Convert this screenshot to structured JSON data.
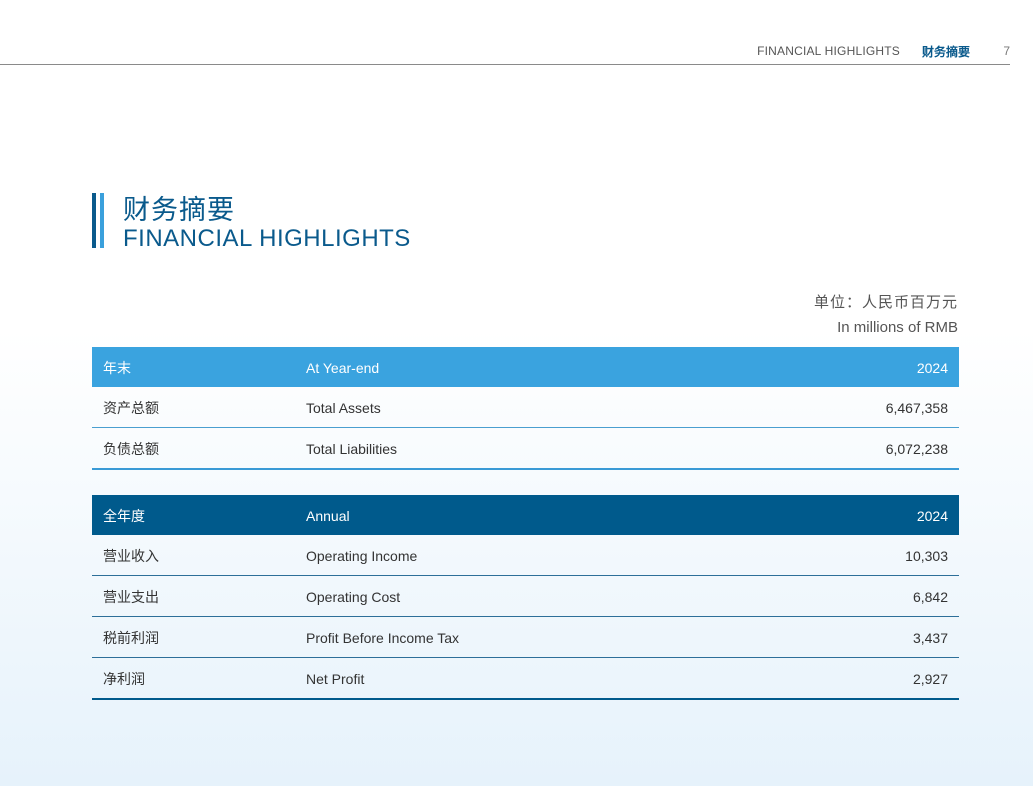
{
  "header": {
    "section_en": "FINANCIAL HIGHLIGHTS",
    "section_cn": "财务摘要",
    "page_number": "7"
  },
  "title": {
    "cn": "财务摘要",
    "en": "FINANCIAL HIGHLIGHTS"
  },
  "unit": {
    "cn": "单位：人民币百万元",
    "en": "In millions of RMB"
  },
  "year_end_table": {
    "header": {
      "cn": "年末",
      "en": "At Year-end",
      "year": "2024"
    },
    "rows": [
      {
        "cn": "资产总额",
        "en": "Total Assets",
        "value": "6,467,358"
      },
      {
        "cn": "负债总额",
        "en": "Total Liabilities",
        "value": "6,072,238"
      }
    ]
  },
  "annual_table": {
    "header": {
      "cn": "全年度",
      "en": "Annual",
      "year": "2024"
    },
    "rows": [
      {
        "cn": "营业收入",
        "en": "Operating Income",
        "value": "10,303"
      },
      {
        "cn": "营业支出",
        "en": "Operating Cost",
        "value": "6,842"
      },
      {
        "cn": "税前利润",
        "en": "Profit Before Income Tax",
        "value": "3,437"
      },
      {
        "cn": "净利润",
        "en": "Net Profit",
        "value": "2,927"
      }
    ]
  },
  "colors": {
    "primary_dark": "#005a8c",
    "primary_light": "#3aa3df"
  }
}
